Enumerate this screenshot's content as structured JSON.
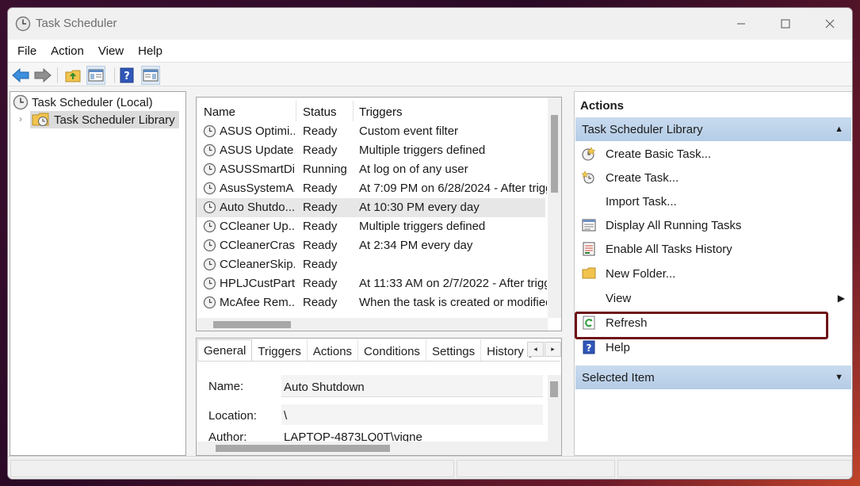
{
  "window": {
    "title": "Task Scheduler"
  },
  "menu": [
    "File",
    "Action",
    "View",
    "Help"
  ],
  "tree": {
    "root": "Task Scheduler (Local)",
    "library": "Task Scheduler Library"
  },
  "task_table": {
    "headers": [
      "Name",
      "Status",
      "Triggers"
    ],
    "rows": [
      {
        "name": "ASUS Optimi...",
        "status": "Ready",
        "trigger": "Custom event filter"
      },
      {
        "name": "ASUS Update...",
        "status": "Ready",
        "trigger": "Multiple triggers defined"
      },
      {
        "name": "ASUSSmartDi...",
        "status": "Running",
        "trigger": "At log on of any user"
      },
      {
        "name": "AsusSystemA...",
        "status": "Ready",
        "trigger": "At 7:09 PM on 6/28/2024 - After trigg"
      },
      {
        "name": "Auto Shutdo...",
        "status": "Ready",
        "trigger": "At 10:30 PM every day"
      },
      {
        "name": "CCleaner Up...",
        "status": "Ready",
        "trigger": "Multiple triggers defined"
      },
      {
        "name": "CCleanerCras...",
        "status": "Ready",
        "trigger": "At 2:34 PM every day"
      },
      {
        "name": "CCleanerSkip...",
        "status": "Ready",
        "trigger": ""
      },
      {
        "name": "HPLJCustPart...",
        "status": "Ready",
        "trigger": "At 11:33 AM on 2/7/2022 - After trigg"
      },
      {
        "name": "McAfee Rem...",
        "status": "Ready",
        "trigger": "When the task is created or modified"
      }
    ],
    "selected_index": 4
  },
  "detail": {
    "tabs": [
      "General",
      "Triggers",
      "Actions",
      "Conditions",
      "Settings",
      "History ("
    ],
    "active_tab": "General",
    "name_label": "Name:",
    "name_value": "Auto Shutdown",
    "location_label": "Location:",
    "location_value": "\\",
    "author_label": "Author:",
    "author_value": "LAPTOP-4873LQ0T\\vigne"
  },
  "actions": {
    "header": "Actions",
    "section": "Task Scheduler Library",
    "items": [
      {
        "label": "Create Basic Task...",
        "icon": "create-basic-task-icon"
      },
      {
        "label": "Create Task...",
        "icon": "create-task-icon"
      },
      {
        "label": "Import Task...",
        "icon": ""
      },
      {
        "label": "Display All Running Tasks",
        "icon": "running-tasks-icon"
      },
      {
        "label": "Enable All Tasks History",
        "icon": "history-icon"
      },
      {
        "label": "New Folder...",
        "icon": "folder-icon"
      },
      {
        "label": "View",
        "icon": ""
      },
      {
        "label": "Refresh",
        "icon": "refresh-icon"
      },
      {
        "label": "Help",
        "icon": "help-icon"
      }
    ],
    "selected_section": "Selected Item"
  },
  "colors": {
    "highlight_border": "#6e1216",
    "section_band": "#bcd2ea"
  }
}
